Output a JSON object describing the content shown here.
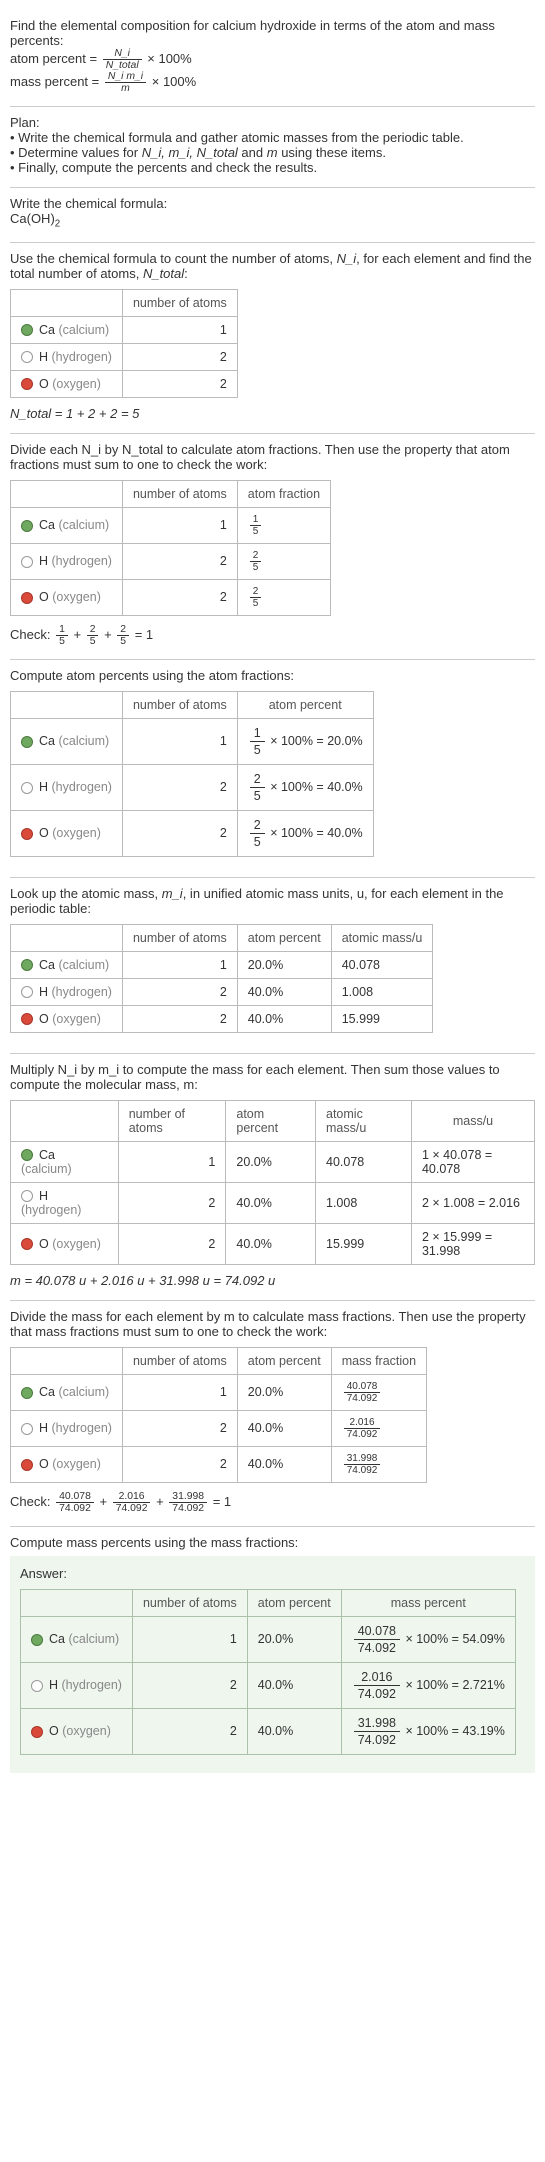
{
  "intro": {
    "line1": "Find the elemental composition for calcium hydroxide in terms of the atom and mass percents:",
    "atom_percent_eq_lhs": "atom percent =",
    "atom_percent_num": "N_i",
    "atom_percent_den": "N_total",
    "times100": "× 100%",
    "mass_percent_eq_lhs": "mass percent =",
    "mass_percent_num": "N_i m_i",
    "mass_percent_den": "m"
  },
  "plan": {
    "heading": "Plan:",
    "b1": "• Write the chemical formula and gather atomic masses from the periodic table.",
    "b2_pre": "• Determine values for ",
    "b2_vars": "N_i, m_i, N_total",
    "b2_mid": " and ",
    "b2_m": "m",
    "b2_post": " using these items.",
    "b3": "• Finally, compute the percents and check the results."
  },
  "formula_section": {
    "line": "Write the chemical formula:",
    "formula_ca": "Ca(OH)",
    "formula_sub": "2"
  },
  "count_section": {
    "text_pre": "Use the chemical formula to count the number of atoms, ",
    "Ni": "N_i",
    "text_mid": ", for each element and find the total number of atoms, ",
    "Ntotal": "N_total",
    "text_post": ":",
    "col_atoms": "number of atoms",
    "elements": {
      "ca": {
        "label": "Ca",
        "name": "(calcium)",
        "n": "1"
      },
      "h": {
        "label": "H",
        "name": "(hydrogen)",
        "n": "2"
      },
      "o": {
        "label": "O",
        "name": "(oxygen)",
        "n": "2"
      }
    },
    "total_eq": "N_total = 1 + 2 + 2 = 5"
  },
  "fraction_section": {
    "text": "Divide each N_i by N_total to calculate atom fractions. Then use the property that atom fractions must sum to one to check the work:",
    "col_atoms": "number of atoms",
    "col_frac": "atom fraction",
    "rows": {
      "ca": {
        "n": "1",
        "num": "1",
        "den": "5"
      },
      "h": {
        "n": "2",
        "num": "2",
        "den": "5"
      },
      "o": {
        "n": "2",
        "num": "2",
        "den": "5"
      }
    },
    "check_label": "Check: ",
    "check_eq_end": " = 1"
  },
  "atom_pct_section": {
    "text": "Compute atom percents using the atom fractions:",
    "col_atoms": "number of atoms",
    "col_pct": "atom percent",
    "rows": {
      "ca": {
        "n": "1",
        "num": "1",
        "den": "5",
        "pct": "= 20.0%"
      },
      "h": {
        "n": "2",
        "num": "2",
        "den": "5",
        "pct": "= 40.0%"
      },
      "o": {
        "n": "2",
        "num": "2",
        "den": "5",
        "pct": "= 40.0%"
      }
    },
    "times100": "× 100% "
  },
  "atomic_mass_section": {
    "text_pre": "Look up the atomic mass, ",
    "mi": "m_i",
    "text_post": ", in unified atomic mass units, u, for each element in the periodic table:",
    "col_atoms": "number of atoms",
    "col_pct": "atom percent",
    "col_mass": "atomic mass/u",
    "rows": {
      "ca": {
        "n": "1",
        "pct": "20.0%",
        "mass": "40.078"
      },
      "h": {
        "n": "2",
        "pct": "40.0%",
        "mass": "1.008"
      },
      "o": {
        "n": "2",
        "pct": "40.0%",
        "mass": "15.999"
      }
    }
  },
  "molar_mass_section": {
    "text": "Multiply N_i by m_i to compute the mass for each element. Then sum those values to compute the molecular mass, m:",
    "col_atoms": "number of atoms",
    "col_pct": "atom percent",
    "col_amass": "atomic mass/u",
    "col_mass": "mass/u",
    "rows": {
      "ca": {
        "n": "1",
        "pct": "20.0%",
        "amass": "40.078",
        "mass": "1 × 40.078 = 40.078"
      },
      "h": {
        "n": "2",
        "pct": "40.0%",
        "amass": "1.008",
        "mass": "2 × 1.008 = 2.016"
      },
      "o": {
        "n": "2",
        "pct": "40.0%",
        "amass": "15.999",
        "mass": "2 × 15.999 = 31.998"
      }
    },
    "sum_eq": "m = 40.078 u + 2.016 u + 31.998 u = 74.092 u"
  },
  "mass_frac_section": {
    "text": "Divide the mass for each element by m to calculate mass fractions. Then use the property that mass fractions must sum to one to check the work:",
    "col_atoms": "number of atoms",
    "col_pct": "atom percent",
    "col_mfrac": "mass fraction",
    "rows": {
      "ca": {
        "n": "1",
        "pct": "20.0%",
        "num": "40.078",
        "den": "74.092"
      },
      "h": {
        "n": "2",
        "pct": "40.0%",
        "num": "2.016",
        "den": "74.092"
      },
      "o": {
        "n": "2",
        "pct": "40.0%",
        "num": "31.998",
        "den": "74.092"
      }
    },
    "check_label": "Check: ",
    "check_end": " = 1"
  },
  "mass_pct_section": {
    "text": "Compute mass percents using the mass fractions:",
    "answer_label": "Answer:",
    "col_atoms": "number of atoms",
    "col_apct": "atom percent",
    "col_mpct": "mass percent",
    "times100": "× 100% ",
    "rows": {
      "ca": {
        "n": "1",
        "apct": "20.0%",
        "num": "40.078",
        "den": "74.092",
        "res": "= 54.09%"
      },
      "h": {
        "n": "2",
        "apct": "40.0%",
        "num": "2.016",
        "den": "74.092",
        "res": "= 2.721%"
      },
      "o": {
        "n": "2",
        "apct": "40.0%",
        "num": "31.998",
        "den": "74.092",
        "res": "= 43.19%"
      }
    }
  },
  "chart_data": null
}
